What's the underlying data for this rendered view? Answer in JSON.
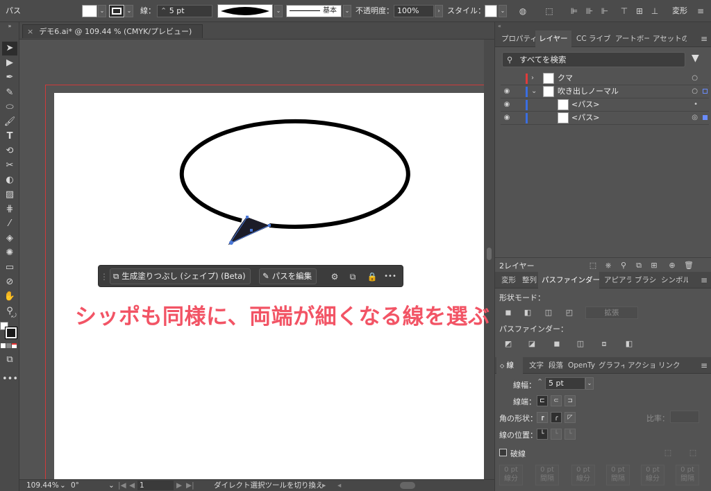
{
  "control_bar": {
    "selection_label": "パス",
    "stroke_label": "線：",
    "stroke_value": "5 pt",
    "brush_label": "基本",
    "opacity_label": "不透明度：",
    "opacity_value": "100%",
    "style_label": "スタイル：",
    "transform_label": "変形"
  },
  "document_tab": {
    "title": "デモ6.ai* @ 109.44 % (CMYK/プレビュー)",
    "close": "×"
  },
  "context_bar": {
    "generative_fill": "生成塗りつぶし (シェイプ) (Beta)",
    "edit_path": "パスを編集",
    "more": "•••"
  },
  "annotation": "シッポも同様に、両端が細くなる線を選ぶ",
  "status_bar": {
    "zoom": "109.44%",
    "rotation": "0°",
    "artboard": "1",
    "message": "ダイレクト選択ツールを切り換え"
  },
  "layers_panel": {
    "tabs": [
      "プロパティ",
      "レイヤー",
      "CC ライブ",
      "アートボー",
      "アセットの"
    ],
    "active_tab": 1,
    "search_placeholder": "すべてを検索",
    "rows": [
      {
        "name": "クマ",
        "color": "#e03a3a"
      },
      {
        "name": "吹き出しノーマル",
        "color": "#3a6ee0"
      },
      {
        "name": "<パス>",
        "color": "#3a6ee0"
      },
      {
        "name": "<パス>",
        "color": "#3a6ee0"
      }
    ],
    "footer": "2レイヤー"
  },
  "pathfinder_panel": {
    "tabs": [
      "変形",
      "整列",
      "パスファインダー",
      "アピアラ",
      "ブラシ",
      "シンボル"
    ],
    "active_tab": 2,
    "shape_modes_label": "形状モード：",
    "expand_button": "拡張",
    "pathfinders_label": "パスファインダー："
  },
  "stroke_panel": {
    "tabs": [
      "線",
      "文字",
      "段落",
      "OpenTy",
      "グラフィ",
      "アクショ",
      "リンク"
    ],
    "weight_label": "線幅：",
    "weight_value": "5 pt",
    "cap_label": "線端：",
    "corner_label": "角の形状：",
    "limit_label": "比率：",
    "align_label": "線の位置：",
    "dashed_label": "破線",
    "dash_cells": [
      {
        "value": "0 pt",
        "label": "線分"
      },
      {
        "value": "0 pt",
        "label": "間隔"
      },
      {
        "value": "0 pt",
        "label": "線分"
      },
      {
        "value": "0 pt",
        "label": "間隔"
      },
      {
        "value": "0 pt",
        "label": "線分"
      },
      {
        "value": "0 pt",
        "label": "間隔"
      }
    ]
  },
  "colors": {
    "bleed": "#d03a3a",
    "annotation": "#f25465",
    "anchor": "#4a78d8"
  }
}
